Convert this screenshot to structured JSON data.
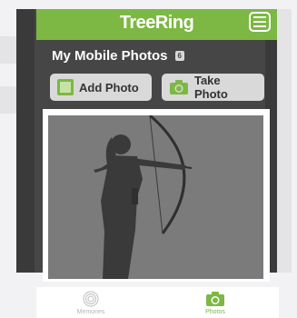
{
  "app": {
    "brand": "TreeRing"
  },
  "page": {
    "title": "My Mobile Photos",
    "photo_count": "6"
  },
  "actions": {
    "add_photo": "Add Photo",
    "take_photo": "Take Photo"
  },
  "tabs": [
    {
      "label": "Memories",
      "icon": "fingerprint-icon",
      "active": false
    },
    {
      "label": "Photos",
      "icon": "camera-icon",
      "active": true
    }
  ],
  "colors": {
    "accent": "#7cb843",
    "panel": "#464646",
    "button": "#d9d9d9"
  }
}
